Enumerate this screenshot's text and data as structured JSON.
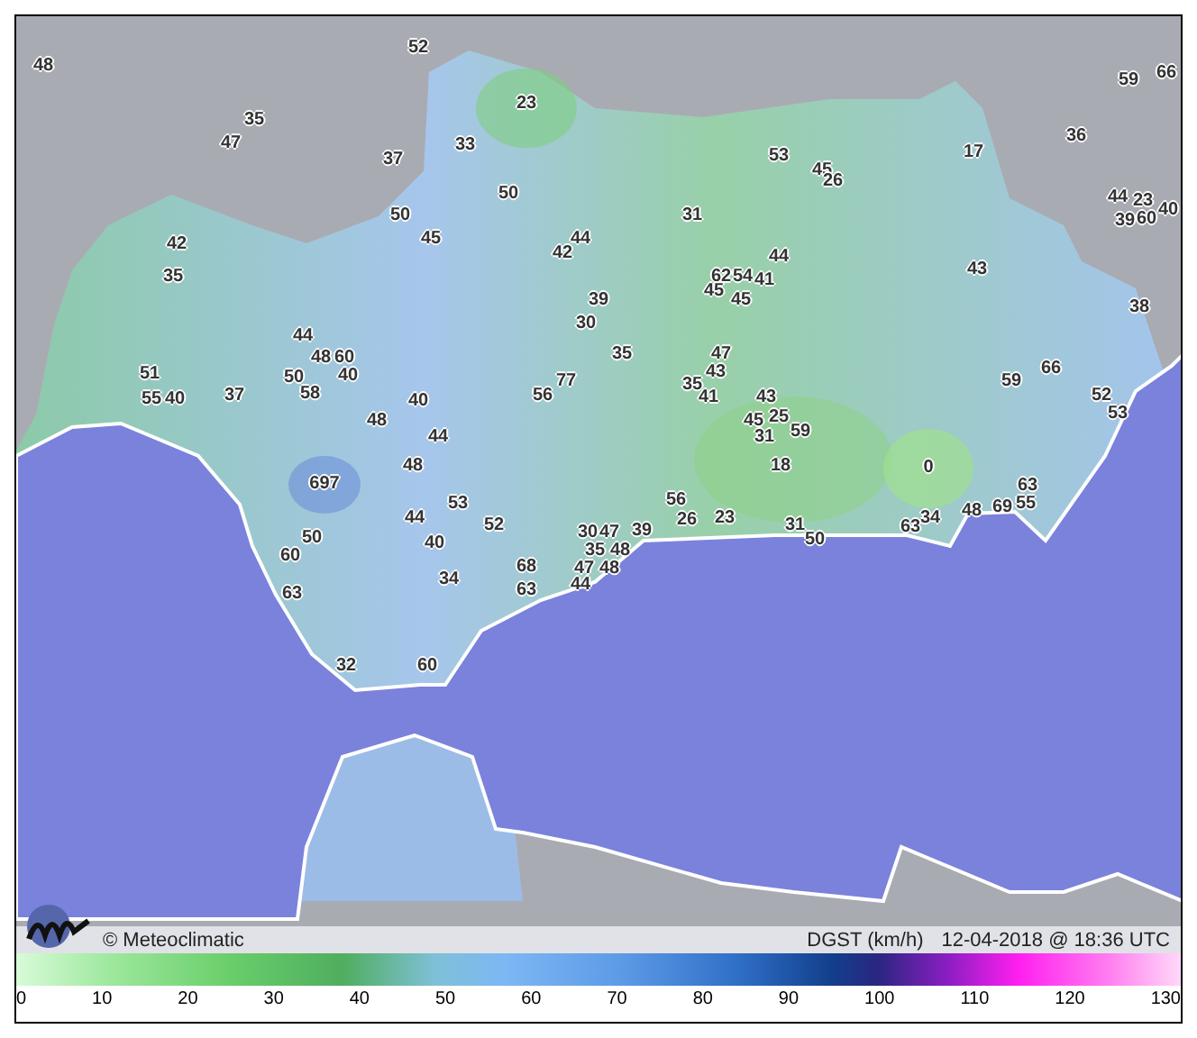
{
  "map": {
    "stations": [
      "52",
      "48",
      "66",
      "59",
      "23",
      "35",
      "47",
      "33",
      "36",
      "37",
      "53",
      "17",
      "45",
      "26",
      "50",
      "44",
      "23",
      "50",
      "31",
      "39",
      "60",
      "40",
      "42",
      "45",
      "44",
      "42",
      "44",
      "43",
      "35",
      "62",
      "54",
      "41",
      "39",
      "45",
      "45",
      "38",
      "30",
      "44",
      "48",
      "60",
      "35",
      "47",
      "51",
      "50",
      "40",
      "77",
      "35",
      "43",
      "59",
      "66",
      "55",
      "40",
      "37",
      "58",
      "40",
      "56",
      "41",
      "43",
      "52",
      "48",
      "45",
      "25",
      "53",
      "44",
      "31",
      "59",
      "48",
      "18",
      "0",
      "697",
      "63",
      "53",
      "56",
      "69",
      "55",
      "44",
      "26",
      "23",
      "34",
      "48",
      "50",
      "40",
      "52",
      "30",
      "47",
      "39",
      "31",
      "50",
      "63",
      "60",
      "35",
      "48",
      "68",
      "47",
      "48",
      "63",
      "34",
      "63",
      "44",
      "32",
      "60"
    ]
  },
  "footer": {
    "credit": "© Meteoclimatic",
    "variable": "DGST (km/h)",
    "timestamp": "12-04-2018 @ 18:36 UTC"
  },
  "legend": {
    "ticks": [
      "0",
      "10",
      "20",
      "30",
      "40",
      "50",
      "60",
      "70",
      "80",
      "90",
      "100",
      "110",
      "120",
      "130"
    ]
  }
}
